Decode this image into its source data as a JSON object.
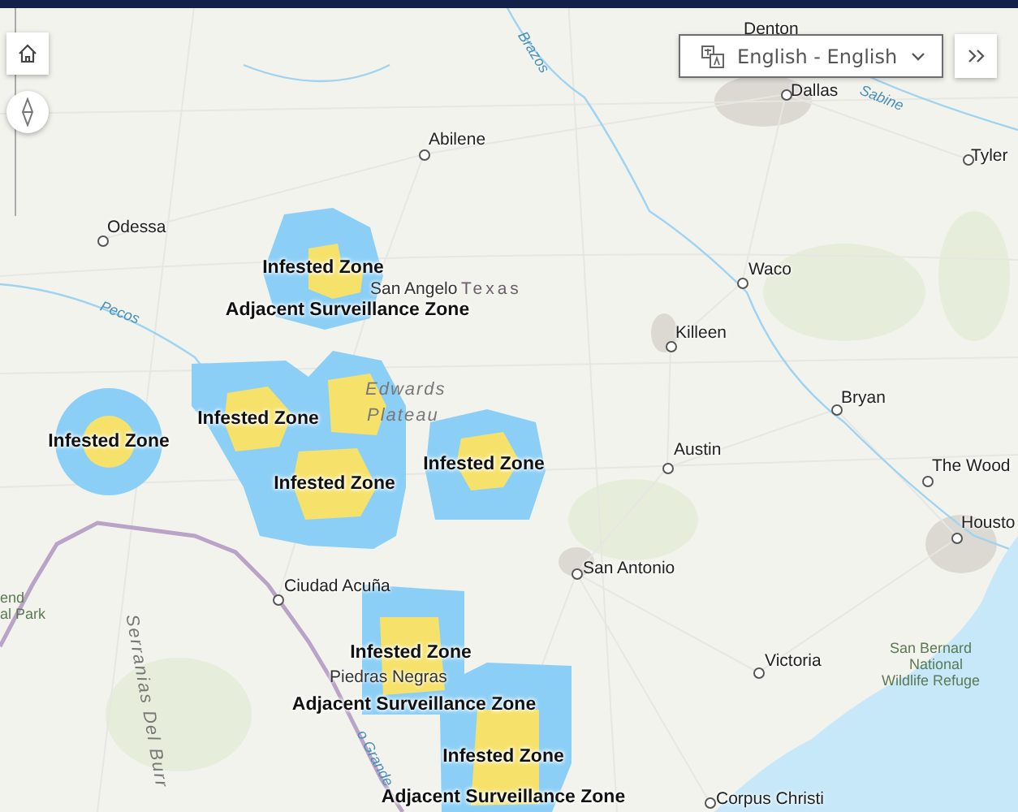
{
  "controls": {
    "language_select": {
      "value": "English - English"
    }
  },
  "map": {
    "places": [
      {
        "name": "Denton",
        "kind": "city"
      },
      {
        "name": "Dallas",
        "kind": "city"
      },
      {
        "name": "Tyler",
        "kind": "city"
      },
      {
        "name": "Abilene",
        "kind": "city"
      },
      {
        "name": "Odessa",
        "kind": "city"
      },
      {
        "name": "San Angelo",
        "kind": "town"
      },
      {
        "name": "Waco",
        "kind": "city"
      },
      {
        "name": "Killeen",
        "kind": "city"
      },
      {
        "name": "Bryan",
        "kind": "city"
      },
      {
        "name": "Austin",
        "kind": "city"
      },
      {
        "name": "The Wood",
        "kind": "city"
      },
      {
        "name": "Housto",
        "kind": "city"
      },
      {
        "name": "San Antonio",
        "kind": "city"
      },
      {
        "name": "Ciudad Acuña",
        "kind": "city"
      },
      {
        "name": "Piedras Negras",
        "kind": "town"
      },
      {
        "name": "Victoria",
        "kind": "city"
      },
      {
        "name": "Corpus Christi",
        "kind": "city"
      }
    ],
    "regions": [
      {
        "name": "Texas",
        "kind": "state"
      },
      {
        "name": "Edwards",
        "kind": "terrain"
      },
      {
        "name": "Plateau",
        "kind": "terrain"
      },
      {
        "name": "Brazos",
        "kind": "river"
      },
      {
        "name": "Sabine",
        "kind": "river"
      },
      {
        "name": "Pecos",
        "kind": "river"
      },
      {
        "name": "o Grande",
        "kind": "river"
      },
      {
        "name": "Serranias Del Burr",
        "kind": "terrain"
      },
      {
        "name": "end",
        "kind": "park"
      },
      {
        "name": "al Park",
        "kind": "park"
      },
      {
        "name": "San Bernard",
        "kind": "park"
      },
      {
        "name": "National",
        "kind": "park"
      },
      {
        "name": "Wildlife Refuge",
        "kind": "park"
      }
    ],
    "zone_labels": [
      {
        "text": "Infested Zone"
      },
      {
        "text": "Adjacent Surveillance Zone"
      },
      {
        "text": "Infested Zone"
      },
      {
        "text": "Infested Zone"
      },
      {
        "text": "Infested Zone"
      },
      {
        "text": "Infested Zone"
      },
      {
        "text": "Infested Zone"
      },
      {
        "text": "Adjacent Surveillance Zone"
      },
      {
        "text": "Infested Zone"
      },
      {
        "text": "Adjacent Surveillance Zone"
      }
    ]
  }
}
